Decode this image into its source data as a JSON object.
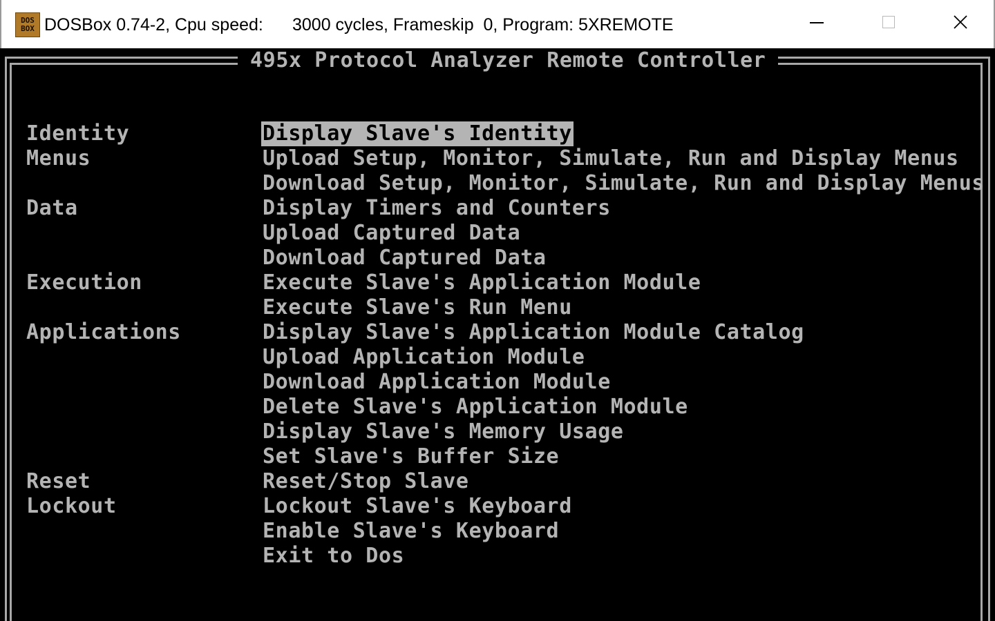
{
  "window": {
    "icon_text_top": "DOS",
    "icon_text_bottom": "BOX",
    "title_prefix": "DOSBox 0.74-2, Cpu speed:",
    "title_rest": "3000 cycles, Frameskip  0, Program: 5XREMOTE",
    "controls": [
      "minimize-icon",
      "maximize-icon",
      "close-icon"
    ]
  },
  "app": {
    "frame_title": "495x Protocol Analyzer Remote Controller",
    "categories": {
      "identity": "Identity",
      "menus": "Menus",
      "data": "Data",
      "execution": "Execution",
      "applications": "Applications",
      "reset": "Reset",
      "lockout": "Lockout"
    },
    "commands": [
      "Display Slave's Identity",
      "Upload Setup, Monitor, Simulate, Run and Display Menus",
      "Download Setup, Monitor, Simulate, Run and Display Menus",
      "Display Timers and Counters",
      "Upload Captured Data",
      "Download Captured Data",
      "Execute Slave's Application Module",
      "Execute Slave's Run Menu",
      "Display Slave's Application Module Catalog",
      "Upload Application Module",
      "Download Application Module",
      "Delete Slave's Application Module",
      "Display Slave's Memory Usage",
      "Set Slave's Buffer Size",
      "Reset/Stop Slave",
      "Lockout Slave's Keyboard",
      "Enable Slave's Keyboard",
      "Exit to Dos"
    ],
    "selected_command": "Display Slave's Identity",
    "colors": {
      "foreground": "#b4b4b4",
      "background": "#000000",
      "highlight_bg": "#b4b4b4",
      "highlight_fg": "#000000"
    }
  }
}
